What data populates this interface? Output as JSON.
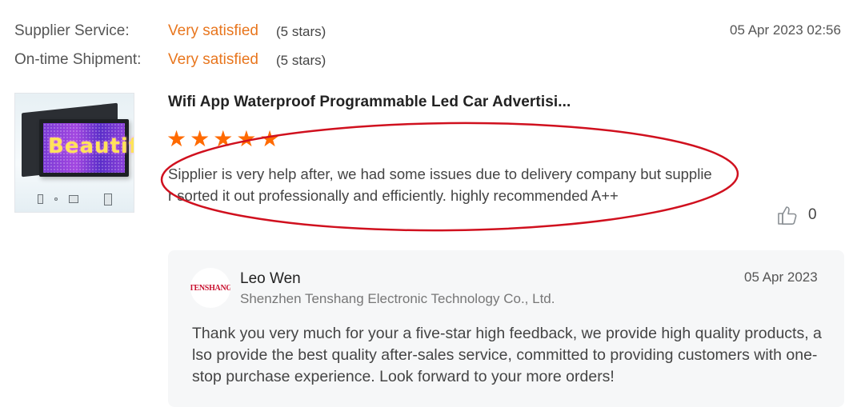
{
  "ratings": [
    {
      "label": "Supplier Service:",
      "value": "Very satisfied",
      "stars": "(5 stars)"
    },
    {
      "label": "On-time Shipment:",
      "value": "Very satisfied",
      "stars": "(5 stars)"
    }
  ],
  "review": {
    "date": "05 Apr 2023 02:56",
    "product_title": "Wifi App Waterproof Programmable Led Car Advertisi...",
    "rating": 5,
    "star_color": "#ff6a00",
    "text": "Sipplier is very help after, we had some issues due to delivery company but supplier sorted it out professionally and efficiently. highly recommended A++",
    "likes": "0",
    "highlight_color": "#d0101e",
    "product_image_text": "Beautiful"
  },
  "reply": {
    "name": "Leo Wen",
    "company": "Shenzhen Tenshang Electronic Technology Co., Ltd.",
    "date": "05 Apr 2023",
    "logo_text": "TENSHANG",
    "text": "Thank you very much for your a five-star high feedback, we provide high quality products, also provide the best quality after-sales service, committed to providing customers with one-stop purchase experience. Look forward to your more orders!"
  },
  "colors": {
    "accent": "#e8761e",
    "reply_background": "#f6f7f8"
  }
}
